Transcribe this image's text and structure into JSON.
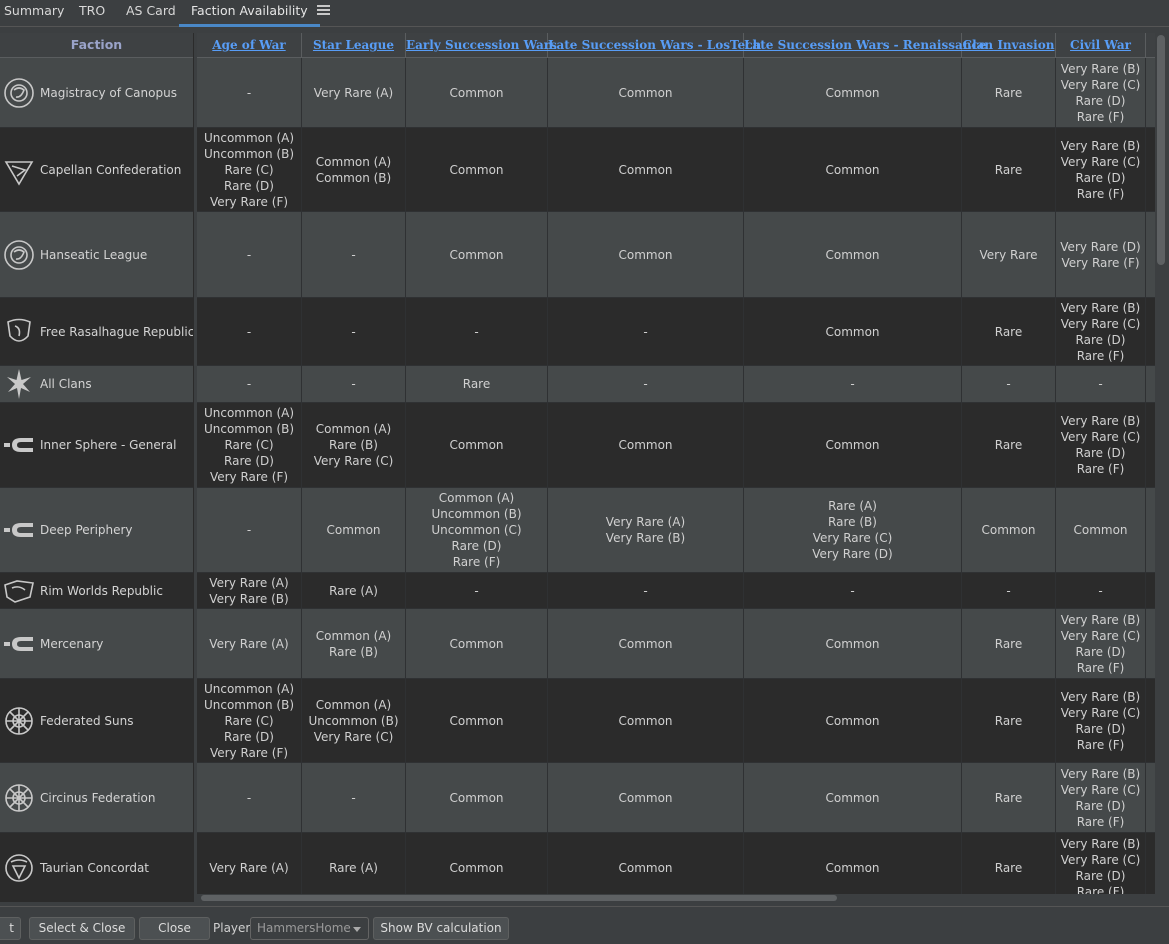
{
  "tabs": [
    {
      "label": "Summary",
      "active": false
    },
    {
      "label": "TRO",
      "active": false
    },
    {
      "label": "AS Card",
      "active": false
    },
    {
      "label": "Faction Availability",
      "active": true
    }
  ],
  "table": {
    "faction_header": "Faction",
    "columns": [
      "Age of War",
      "Star League",
      "Early Succession Wars",
      "Late Succession Wars - LosTech",
      "Late Succession Wars - Renaissance",
      "Clan Invasion",
      "Civil War"
    ],
    "rows": [
      {
        "faction": "Magistracy of Canopus",
        "icon": "magistracy-emblem-icon",
        "cells": [
          [
            "-"
          ],
          [
            "Very Rare (A)"
          ],
          [
            "Common"
          ],
          [
            "Common"
          ],
          [
            "Common"
          ],
          [
            "Rare"
          ],
          [
            "Very Rare (B)",
            "Very Rare (C)",
            "Rare (D)",
            "Rare (F)"
          ]
        ]
      },
      {
        "faction": "Capellan Confederation",
        "icon": "capellan-emblem-icon",
        "cells": [
          [
            "Uncommon (A)",
            "Uncommon (B)",
            "Rare (C)",
            "Rare (D)",
            "Very Rare (F)"
          ],
          [
            "Common (A)",
            "Common (B)"
          ],
          [
            "Common"
          ],
          [
            "Common"
          ],
          [
            "Common"
          ],
          [
            "Rare"
          ],
          [
            "Very Rare (B)",
            "Very Rare (C)",
            "Rare (D)",
            "Rare (F)"
          ]
        ]
      },
      {
        "faction": "Hanseatic League",
        "icon": "hanseatic-emblem-icon",
        "cells": [
          [
            "-"
          ],
          [
            "-"
          ],
          [
            "Common"
          ],
          [
            "Common"
          ],
          [
            "Common"
          ],
          [
            "Very Rare"
          ],
          [
            "Very Rare (D)",
            "Very Rare (F)"
          ]
        ]
      },
      {
        "faction": "Free Rasalhague Republic",
        "icon": "rasalhague-emblem-icon",
        "cells": [
          [
            "-"
          ],
          [
            "-"
          ],
          [
            "-"
          ],
          [
            "-"
          ],
          [
            "Common"
          ],
          [
            "Rare"
          ],
          [
            "Very Rare (B)",
            "Very Rare (C)",
            "Rare (D)",
            "Rare (F)"
          ]
        ]
      },
      {
        "faction": "All Clans",
        "icon": "clans-star-icon",
        "cells": [
          [
            "-"
          ],
          [
            "-"
          ],
          [
            "Rare"
          ],
          [
            "-"
          ],
          [
            "-"
          ],
          [
            "-"
          ],
          [
            "-"
          ]
        ]
      },
      {
        "faction": "Inner Sphere - General",
        "icon": "inner-sphere-emblem-icon",
        "cells": [
          [
            "Uncommon (A)",
            "Uncommon (B)",
            "Rare (C)",
            "Rare (D)",
            "Very Rare (F)"
          ],
          [
            "Common (A)",
            "Rare (B)",
            "Very Rare (C)"
          ],
          [
            "Common"
          ],
          [
            "Common"
          ],
          [
            "Common"
          ],
          [
            "Rare"
          ],
          [
            "Very Rare (B)",
            "Very Rare (C)",
            "Rare (D)",
            "Rare (F)"
          ]
        ]
      },
      {
        "faction": "Deep Periphery",
        "icon": "deep-periphery-emblem-icon",
        "cells": [
          [
            "-"
          ],
          [
            "Common"
          ],
          [
            "Common (A)",
            "Uncommon (B)",
            "Uncommon (C)",
            "Rare (D)",
            "Rare (F)"
          ],
          [
            "Very Rare (A)",
            "Very Rare (B)"
          ],
          [
            "Rare (A)",
            "Rare (B)",
            "Very Rare (C)",
            "Very Rare (D)"
          ],
          [
            "Common"
          ],
          [
            "Common"
          ]
        ]
      },
      {
        "faction": "Rim Worlds Republic",
        "icon": "rim-worlds-emblem-icon",
        "cells": [
          [
            "Very Rare (A)",
            "Very Rare (B)"
          ],
          [
            "Rare (A)"
          ],
          [
            "-"
          ],
          [
            "-"
          ],
          [
            "-"
          ],
          [
            "-"
          ],
          [
            "-"
          ]
        ]
      },
      {
        "faction": "Mercenary",
        "icon": "mercenary-emblem-icon",
        "cells": [
          [
            "Very Rare (A)"
          ],
          [
            "Common (A)",
            "Rare (B)"
          ],
          [
            "Common"
          ],
          [
            "Common"
          ],
          [
            "Common"
          ],
          [
            "Rare"
          ],
          [
            "Very Rare (B)",
            "Very Rare (C)",
            "Rare (D)",
            "Rare (F)"
          ]
        ]
      },
      {
        "faction": "Federated Suns",
        "icon": "federated-suns-emblem-icon",
        "cells": [
          [
            "Uncommon (A)",
            "Uncommon (B)",
            "Rare (C)",
            "Rare (D)",
            "Very Rare (F)"
          ],
          [
            "Common (A)",
            "Uncommon (B)",
            "Very Rare (C)"
          ],
          [
            "Common"
          ],
          [
            "Common"
          ],
          [
            "Common"
          ],
          [
            "Rare"
          ],
          [
            "Very Rare (B)",
            "Very Rare (C)",
            "Rare (D)",
            "Rare (F)"
          ]
        ]
      },
      {
        "faction": "Circinus Federation",
        "icon": "circinus-emblem-icon",
        "cells": [
          [
            "-"
          ],
          [
            "-"
          ],
          [
            "Common"
          ],
          [
            "Common"
          ],
          [
            "Common"
          ],
          [
            "Rare"
          ],
          [
            "Very Rare (B)",
            "Very Rare (C)",
            "Rare (D)",
            "Rare (F)"
          ]
        ]
      },
      {
        "faction": "Taurian Concordat",
        "icon": "taurian-emblem-icon",
        "cells": [
          [
            "Very Rare (A)"
          ],
          [
            "Rare (A)"
          ],
          [
            "Common"
          ],
          [
            "Common"
          ],
          [
            "Common"
          ],
          [
            "Rare"
          ],
          [
            "Very Rare (B)",
            "Very Rare (C)",
            "Rare (D)",
            "Rare (F)"
          ]
        ]
      }
    ]
  },
  "bottom": {
    "partial_button": "t",
    "select_close": "Select & Close",
    "close": "Close",
    "player_label": "Player:",
    "player_value": "HammersHome",
    "show_bv": "Show BV calculation"
  },
  "colors": {
    "header_link": "#589df6",
    "active_tab": "#4a88c7",
    "row_dark": "#2b2b2b",
    "row_light": "#45494a"
  }
}
